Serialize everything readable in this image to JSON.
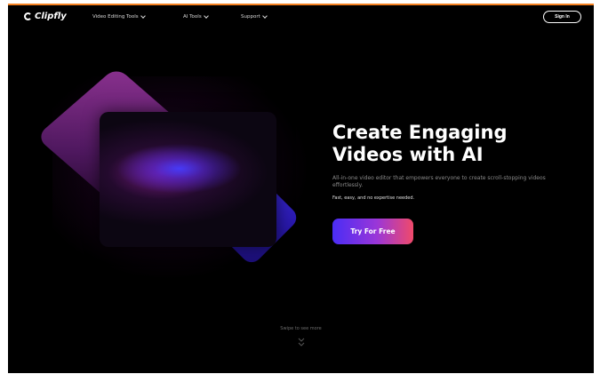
{
  "brand": {
    "name": "Clipfly"
  },
  "nav": {
    "items": [
      {
        "label": "Video Editing Tools"
      },
      {
        "label": "AI Tools"
      },
      {
        "label": "Support"
      }
    ],
    "signin_label": "Sign In"
  },
  "hero": {
    "headline_line1": "Create Engaging",
    "headline_line2": "Videos with AI",
    "subtitle": "All-in-one video editor that empowers everyone to create scroll-stopping videos effortlessly.",
    "subtitle2": "Fast, easy, and no expertise needed.",
    "cta_label": "Try For Free"
  },
  "footer_hint": {
    "label": "Swipe to see more"
  },
  "colors": {
    "accent_top": "#f4801f",
    "cta_start": "#4a2df5",
    "cta_end": "#f04a6a",
    "background": "#000000"
  },
  "icons": {
    "logo": "clipfly-logo-icon",
    "chevron": "chevron-down-icon",
    "swipe": "double-chevron-down-icon"
  }
}
